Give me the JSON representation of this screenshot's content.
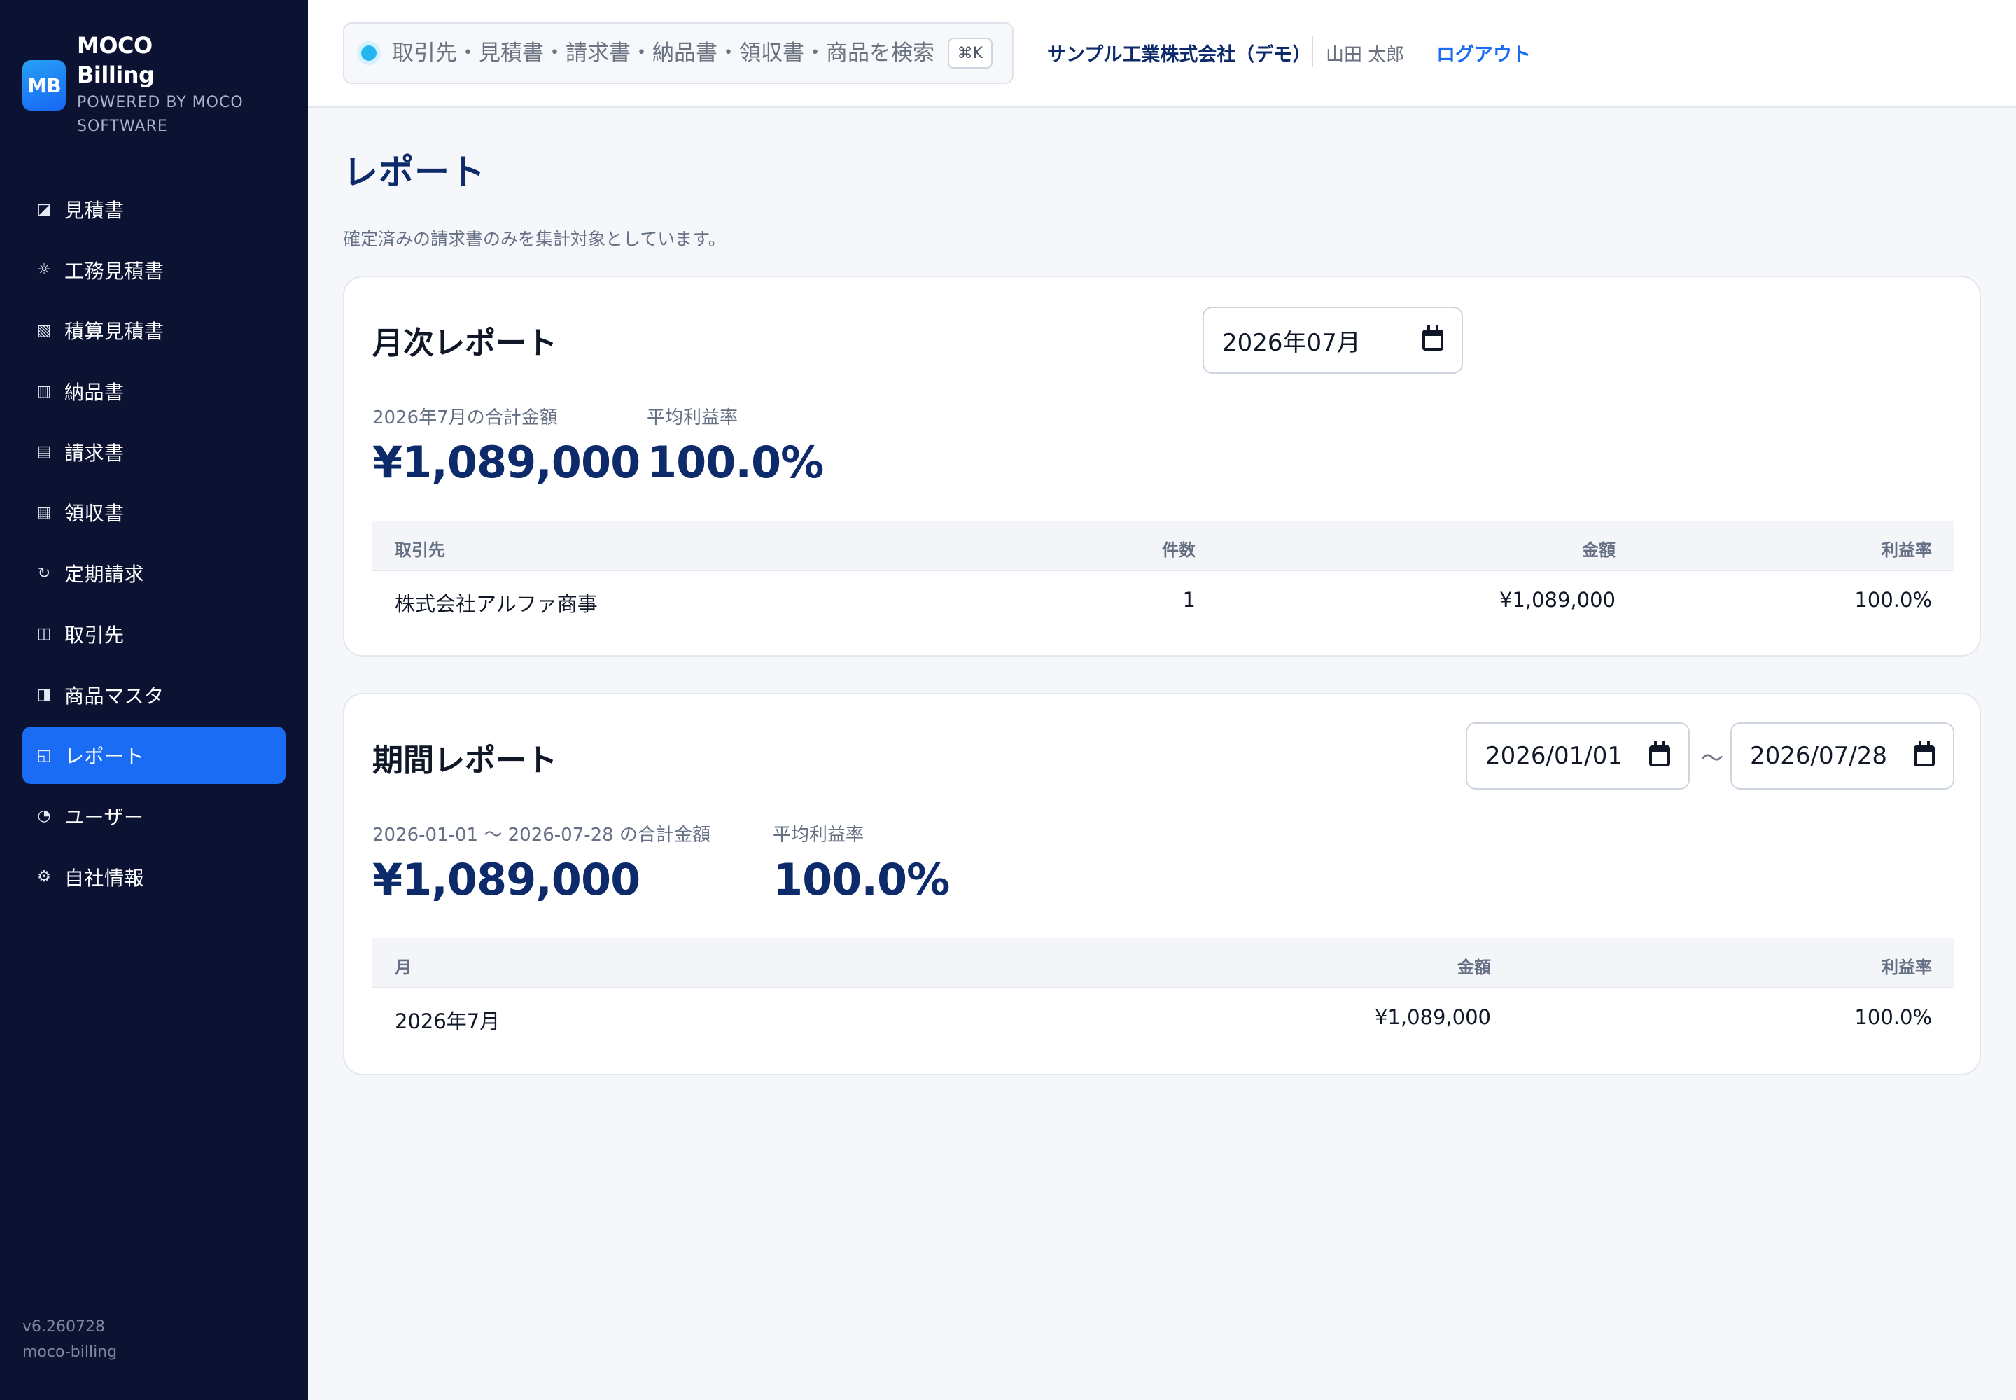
{
  "brand": {
    "logo": "MB",
    "name_line1": "MOCO",
    "name_line2": "Billing",
    "sub_line1": "POWERED BY MOCO",
    "sub_line2": "SOFTWARE"
  },
  "sidebar": {
    "items": [
      {
        "label": "見積書",
        "icon": "document-half-icon",
        "glyph": "◪"
      },
      {
        "label": "工務見積書",
        "icon": "gear-icon",
        "glyph": "☼"
      },
      {
        "label": "積算見積書",
        "icon": "hatched-square-icon",
        "glyph": "▧"
      },
      {
        "label": "納品書",
        "icon": "columns-icon",
        "glyph": "▥"
      },
      {
        "label": "請求書",
        "icon": "lines-icon",
        "glyph": "▤"
      },
      {
        "label": "領収書",
        "icon": "grid-icon",
        "glyph": "▦"
      },
      {
        "label": "定期請求",
        "icon": "refresh-icon",
        "glyph": "↻"
      },
      {
        "label": "取引先",
        "icon": "book-icon",
        "glyph": "◫"
      },
      {
        "label": "商品マスタ",
        "icon": "half-square-icon",
        "glyph": "◨"
      },
      {
        "label": "レポート",
        "icon": "report-icon",
        "glyph": "◱",
        "active": true
      },
      {
        "label": "ユーザー",
        "icon": "pie-icon",
        "glyph": "◔"
      },
      {
        "label": "自社情報",
        "icon": "settings-icon",
        "glyph": "⚙"
      }
    ],
    "version": "v6.260728",
    "app_id": "moco-billing"
  },
  "topbar": {
    "search_placeholder": "取引先・見積書・請求書・納品書・領収書・商品を検索",
    "search_shortcut": "⌘K",
    "company": "サンプル工業株式会社（デモ）",
    "user": "山田 太郎",
    "logout": "ログアウト"
  },
  "page": {
    "title": "レポート",
    "note": "確定済みの請求書のみを集計対象としています。"
  },
  "monthly": {
    "title": "月次レポート",
    "month_value": "2026年07月",
    "total_label": "2026年7月の合計金額",
    "total_value": "¥1,089,000",
    "margin_label": "平均利益率",
    "margin_value": "100.0%",
    "columns": [
      "取引先",
      "件数",
      "金額",
      "利益率"
    ],
    "rows": [
      {
        "client": "株式会社アルファ商事",
        "count": "1",
        "amount": "¥1,089,000",
        "margin": "100.0%"
      }
    ]
  },
  "period": {
    "title": "期間レポート",
    "start_value": "2026/01/01",
    "separator": "〜",
    "end_value": "2026/07/28",
    "total_label": "2026-01-01 〜 2026-07-28 の合計金額",
    "total_value": "¥1,089,000",
    "margin_label": "平均利益率",
    "margin_value": "100.0%",
    "columns": [
      "月",
      "金額",
      "利益率"
    ],
    "rows": [
      {
        "month": "2026年7月",
        "amount": "¥1,089,000",
        "margin": "100.0%"
      }
    ]
  },
  "colors": {
    "sidebar_bg": "#0b1232",
    "accent": "#1a6cf5",
    "heading": "#0d2a6b",
    "page_bg": "#f6f7fb"
  }
}
